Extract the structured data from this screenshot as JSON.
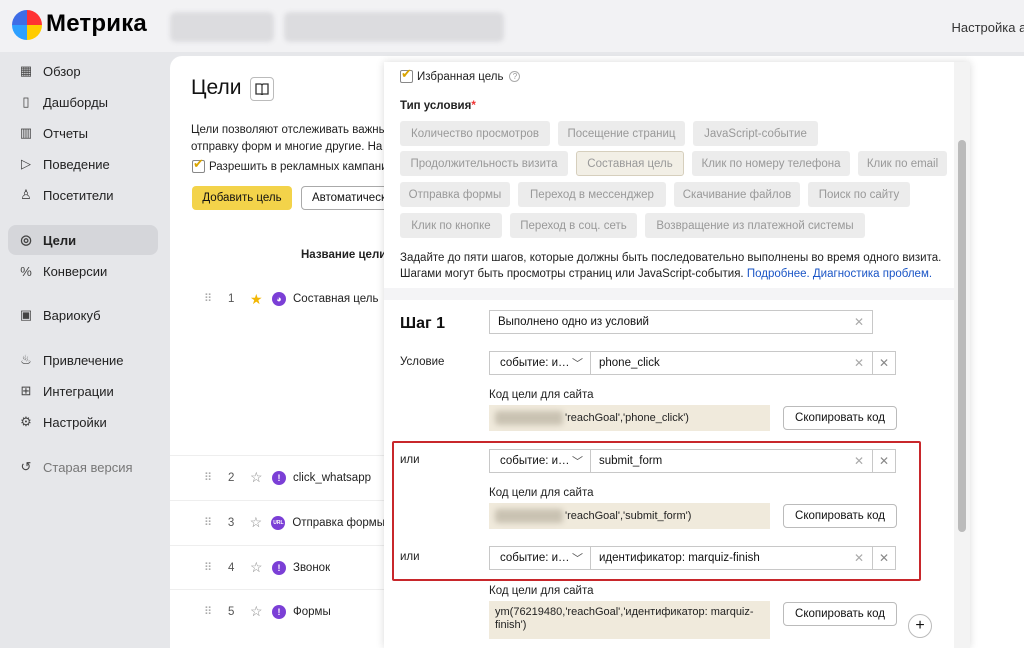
{
  "header": {
    "logo_text": "Метрика",
    "right_text": "Настройка ак"
  },
  "sidebar": {
    "items": [
      {
        "label": "Обзор",
        "icon": "grid-icon",
        "glyph": "▦"
      },
      {
        "label": "Дашборды",
        "icon": "dashboards-icon",
        "glyph": "▯"
      },
      {
        "label": "Отчеты",
        "icon": "bar-chart-icon",
        "glyph": "▥"
      },
      {
        "label": "Поведение",
        "icon": "play-icon",
        "glyph": "▷"
      },
      {
        "label": "Посетители",
        "icon": "person-icon",
        "glyph": "♙"
      },
      {
        "label": "Цели",
        "icon": "target-icon",
        "glyph": "◎"
      },
      {
        "label": "Конверсии",
        "icon": "percent-icon",
        "glyph": "%"
      },
      {
        "label": "Вариокуб",
        "icon": "cube-icon",
        "glyph": "▣"
      },
      {
        "label": "Привлечение",
        "icon": "fire-icon",
        "glyph": "♨"
      },
      {
        "label": "Интеграции",
        "icon": "integrations-icon",
        "glyph": "⊞"
      },
      {
        "label": "Настройки",
        "icon": "gear-icon",
        "glyph": "⚙"
      },
      {
        "label": "Старая версия",
        "icon": "history-icon",
        "glyph": "↺"
      }
    ],
    "active": "Цели"
  },
  "main": {
    "title": "Цели",
    "description_line1": "Цели позволяют отслеживать важные",
    "description_line2": "отправку форм и многие другие. На с",
    "ads_checkbox_label": "Разрешить в рекламных кампани",
    "add_goal_label": "Добавить цель",
    "auto_label": "Автоматически",
    "column_header": "Название цели",
    "goals": [
      {
        "num": "1",
        "name": "Составная цель",
        "favorite": true,
        "icon_glyph": "◕"
      },
      {
        "num": "2",
        "name": "click_whatsapp",
        "favorite": false,
        "icon_glyph": "!"
      },
      {
        "num": "3",
        "name": "Отправка формы",
        "favorite": false,
        "icon_glyph": "URL"
      },
      {
        "num": "4",
        "name": "Звонок",
        "favorite": false,
        "icon_glyph": "!"
      },
      {
        "num": "5",
        "name": "Формы",
        "favorite": false,
        "icon_glyph": "!"
      }
    ]
  },
  "modal": {
    "favorite_label": "Избранная цель",
    "condition_type_label": "Тип условия",
    "condition_types": [
      "Количество просмотров",
      "Посещение страниц",
      "JavaScript-событие",
      "Продолжительность визита",
      "Составная цель",
      "Клик по номеру телефона",
      "Клик по email",
      "Отправка формы",
      "Переход в мессенджер",
      "Скачивание файлов",
      "Поиск по сайту",
      "Клик по кнопке",
      "Переход в соц. сеть",
      "Возвращение из платежной системы"
    ],
    "selected_type": "Составная цель",
    "help_line1": "Задайте до пяти шагов, которые должны быть последовательно выполнены во время одного визита.",
    "help_line2": "Шагами могут быть просмотры страниц или JavaScript-события.",
    "help_link1": "Подробнее.",
    "help_link2": "Диагностика проблем.",
    "step_title": "Шаг 1",
    "step_name_value": "Выполнено одно из условий",
    "condition_label": "Условие",
    "or_label": "или",
    "code_label": "Код цели для сайта",
    "copy_label": "Скопировать код",
    "conditions": [
      {
        "type": "событие: и…",
        "value": "phone_click",
        "code": "'reachGoal','phone_click')"
      },
      {
        "type": "событие: и…",
        "value": "submit_form",
        "code": "'reachGoal','submit_form')"
      },
      {
        "type": "событие: и…",
        "value": "идентификатор: marquiz-finish",
        "code": "ym(76219480,'reachGoal','идентификатор: marquiz-finish')"
      }
    ],
    "plus_label": "+"
  }
}
